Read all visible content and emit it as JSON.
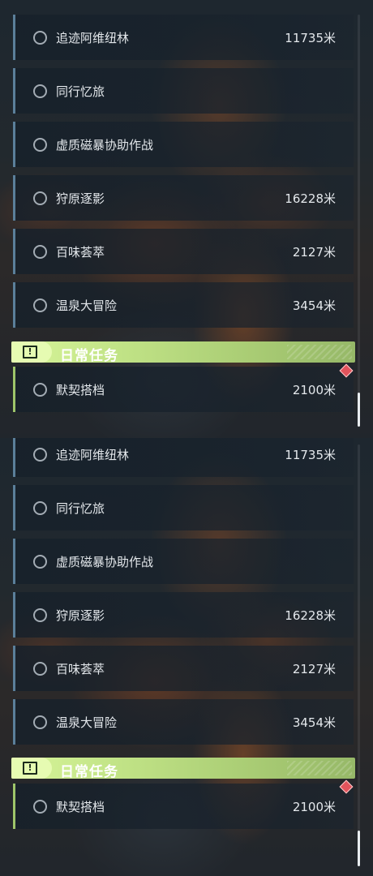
{
  "panels": [
    {
      "regional_tasks": [
        {
          "name": "追迹阿维纽林",
          "distance": "11735米"
        },
        {
          "name": "同行忆旅",
          "distance": ""
        },
        {
          "name": "虚质磁暴协助作战",
          "distance": ""
        },
        {
          "name": "狩原逐影",
          "distance": "16228米"
        },
        {
          "name": "百味荟萃",
          "distance": "2127米"
        },
        {
          "name": "温泉大冒险",
          "distance": "3454米"
        }
      ],
      "section": {
        "title": "日常任务",
        "icon": "exclamation-icon"
      },
      "daily_tasks": [
        {
          "name": "默契搭档",
          "distance": "2100米"
        }
      ]
    },
    {
      "regional_tasks": [
        {
          "name": "追迹阿维纽林",
          "distance": "11735米"
        },
        {
          "name": "同行忆旅",
          "distance": ""
        },
        {
          "name": "虚质磁暴协助作战",
          "distance": ""
        },
        {
          "name": "狩原逐影",
          "distance": "16228米"
        },
        {
          "name": "百味荟萃",
          "distance": "2127米"
        },
        {
          "name": "温泉大冒险",
          "distance": "3454米"
        }
      ],
      "section": {
        "title": "日常任务",
        "icon": "exclamation-icon"
      },
      "daily_tasks": [
        {
          "name": "默契搭档",
          "distance": "2100米"
        }
      ]
    }
  ],
  "colors": {
    "regional_accent": "#5b7f9a",
    "daily_accent": "#9ec56a",
    "section_bar": "#c2e487",
    "marker": "#e2545c",
    "text": "#e4e8ec"
  }
}
